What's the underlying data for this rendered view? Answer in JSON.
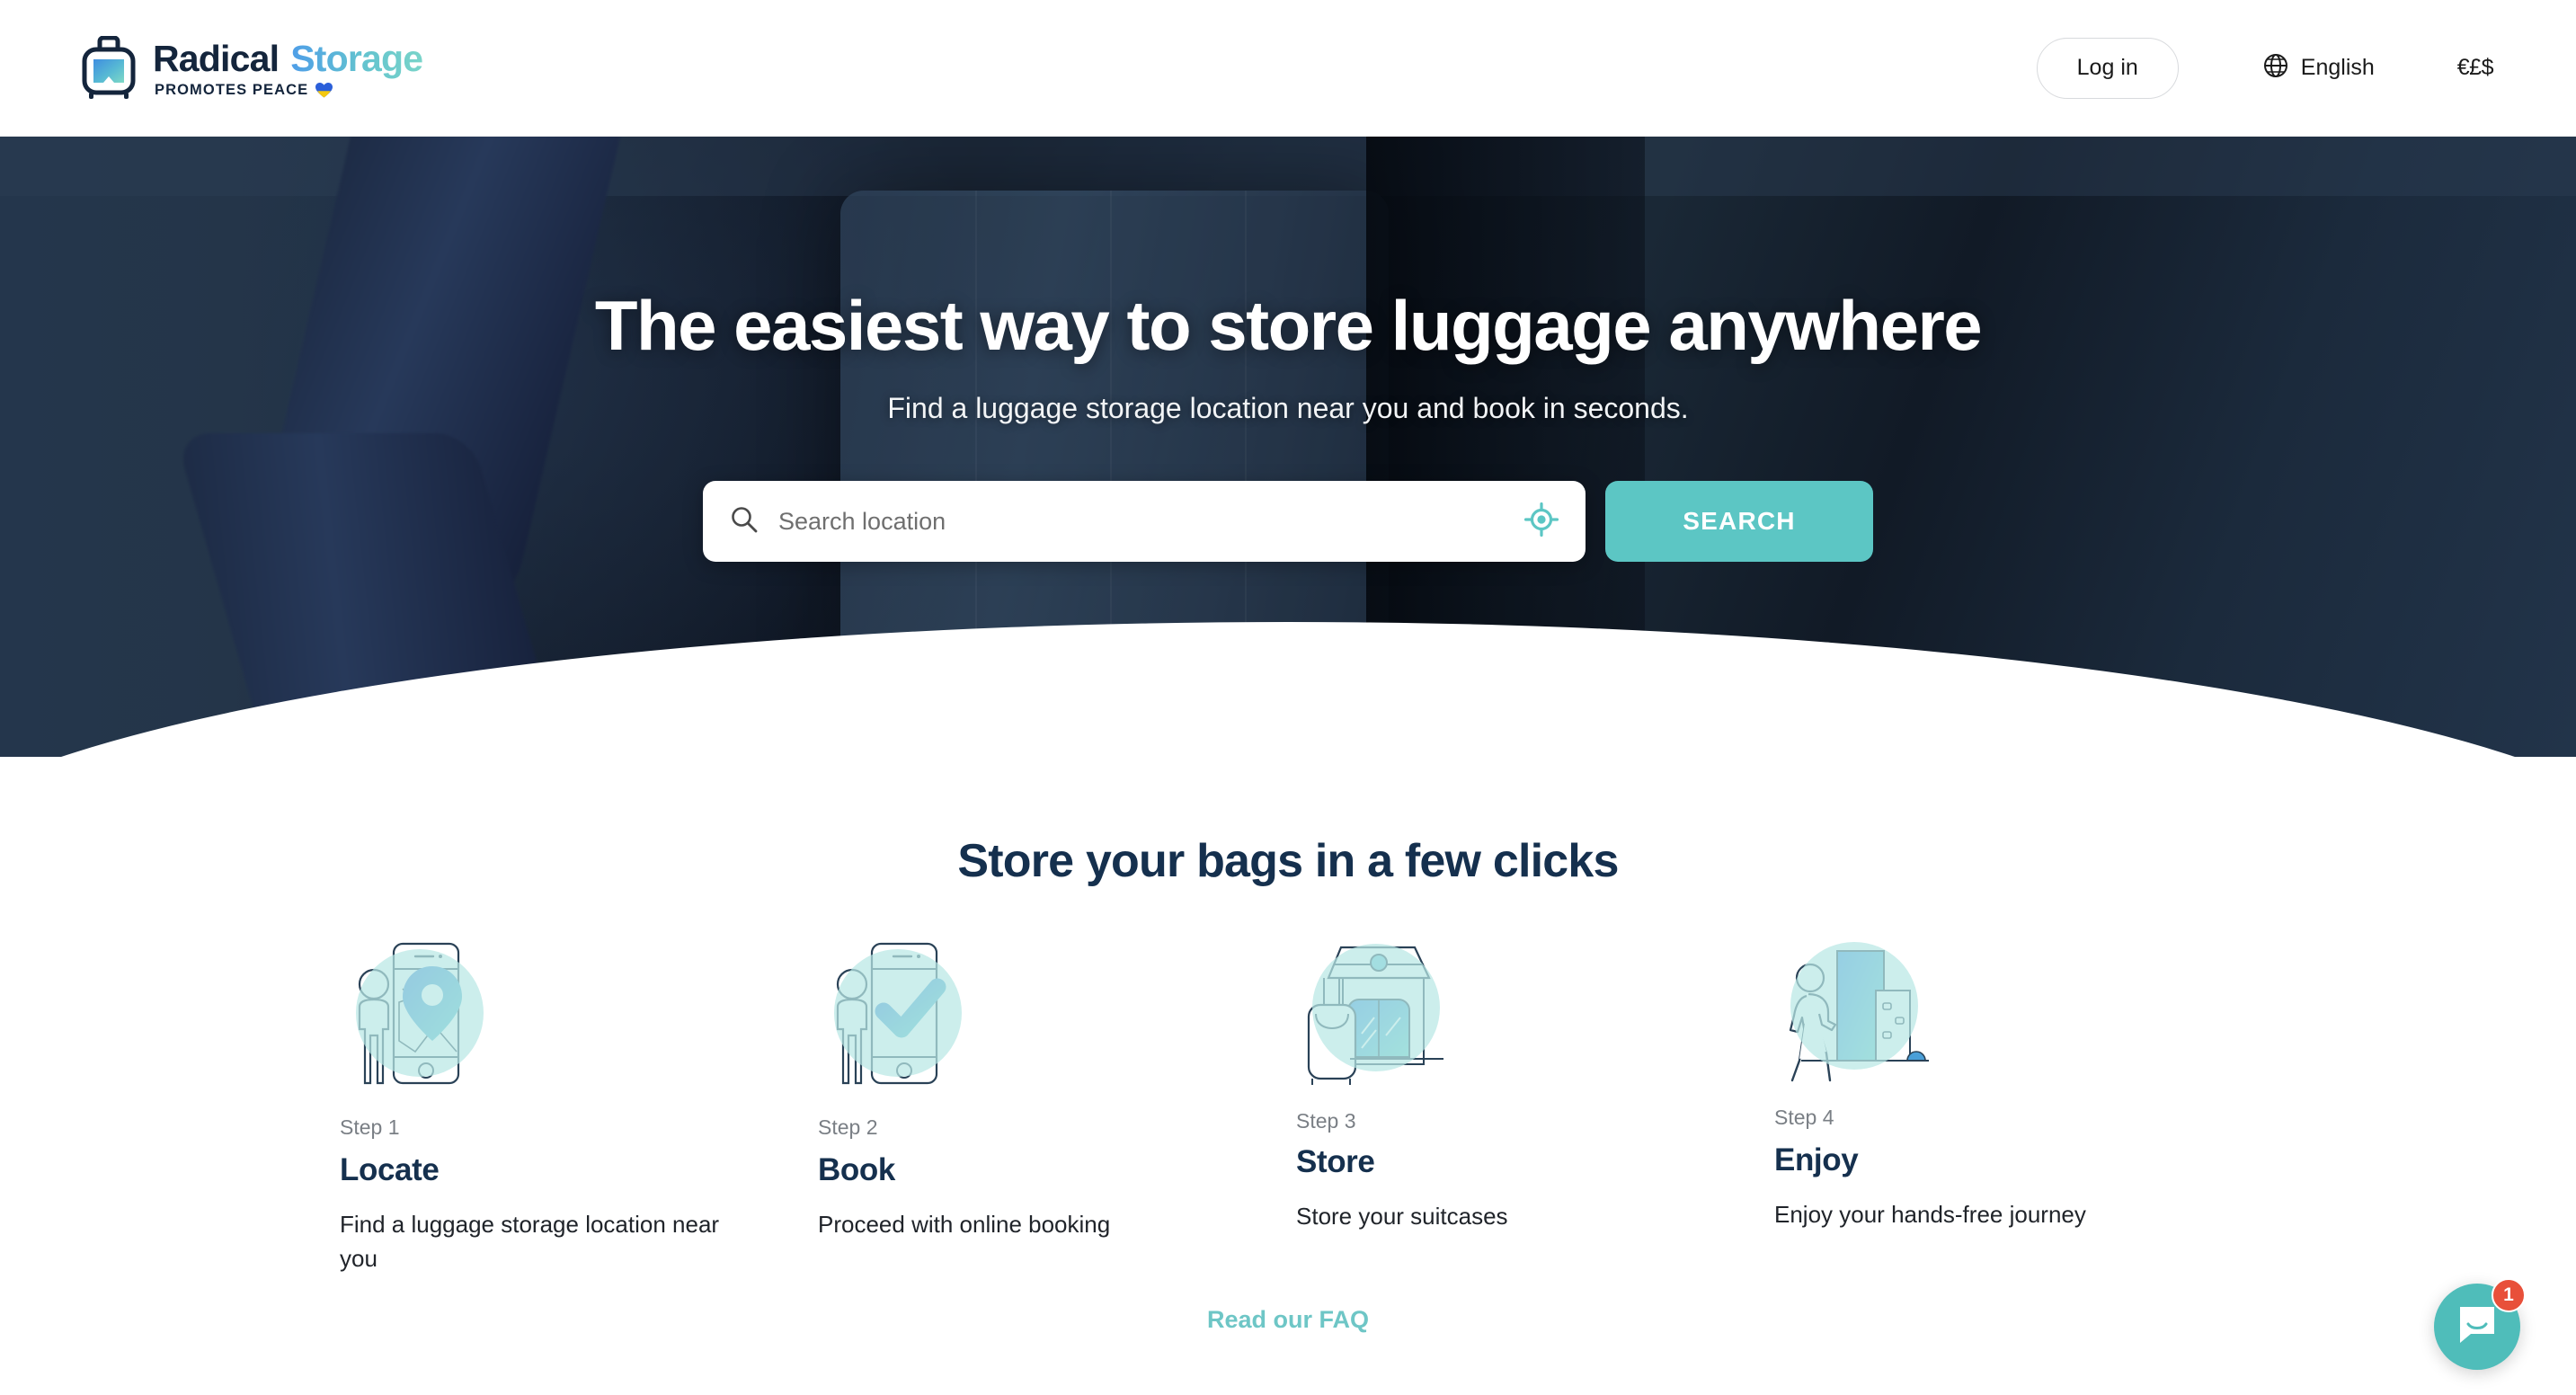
{
  "header": {
    "logo": {
      "name_primary": "Radical",
      "name_secondary": "Storage",
      "tagline": "PROMOTES PEACE",
      "bag_icon": "suitcase-icon",
      "heart_icon": "ukraine-heart-icon"
    },
    "login_label": "Log in",
    "language": {
      "icon": "globe-icon",
      "label": "English"
    },
    "currency": {
      "label": "€£$"
    }
  },
  "hero": {
    "title": "The easiest way to store luggage anywhere",
    "subtitle": "Find a luggage storage location near you and book in seconds.",
    "search": {
      "icon": "search-icon",
      "placeholder": "Search location",
      "value": "",
      "geo_icon": "geolocate-icon",
      "button_label": "SEARCH"
    }
  },
  "steps_section": {
    "title": "Store your bags in a few clicks",
    "faq_link": "Read our FAQ",
    "steps": [
      {
        "number": "Step 1",
        "name": "Locate",
        "desc": "Find a luggage storage location near you",
        "illustration": "person-phone-map-pin-illustration"
      },
      {
        "number": "Step 2",
        "name": "Book",
        "desc": "Proceed with online booking",
        "illustration": "person-phone-checkmark-illustration"
      },
      {
        "number": "Step 3",
        "name": "Store",
        "desc": "Store your suitcases",
        "illustration": "shop-suitcase-illustration"
      },
      {
        "number": "Step 4",
        "name": "Enjoy",
        "desc": "Enjoy your hands-free journey",
        "illustration": "person-walking-city-illustration"
      }
    ]
  },
  "chat": {
    "icon": "chat-bubble-icon",
    "badge_count": "1"
  },
  "colors": {
    "accent_teal": "#5cc6c4",
    "navy": "#15304e",
    "hero_dark": "#131d2c",
    "badge_red": "#e8503a",
    "logo_blue": "#4f9ee8"
  }
}
